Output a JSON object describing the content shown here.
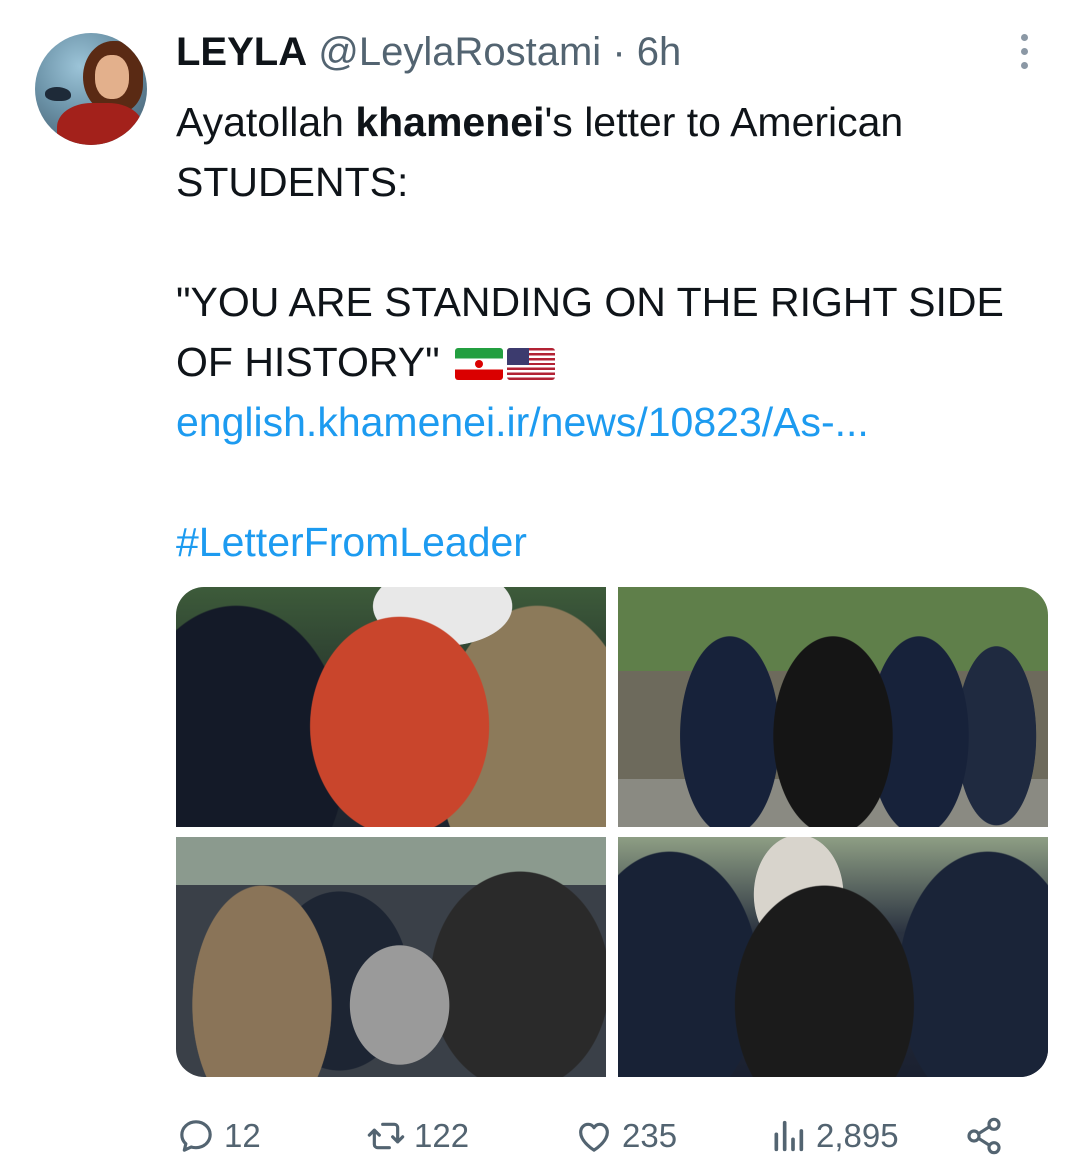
{
  "tweet": {
    "author_name": "LEYLA",
    "handle": "@LeylaRostami",
    "separator": "·",
    "time": "6h",
    "text_pre": "Ayatollah ",
    "text_bold": "khamenei",
    "text_post": "'s letter to American STUDENTS:",
    "quote": "\"YOU ARE STANDING ON THE RIGHT SIDE OF HISTORY\"",
    "flags": [
      "flag-iran",
      "flag-usa"
    ],
    "link": "english.khamenei.ir/news/10823/As-...",
    "hashtag": "#LetterFromLeader"
  },
  "media": [
    {
      "name": "photo-arrest-red-shirt"
    },
    {
      "name": "photo-arrest-black-shirt"
    },
    {
      "name": "photo-arrest-car"
    },
    {
      "name": "photo-arrest-polizei"
    }
  ],
  "actions": {
    "replies": "12",
    "reposts": "122",
    "likes": "235",
    "views": "2,895"
  },
  "icons": [
    "more-icon",
    "reply-icon",
    "repost-icon",
    "like-icon",
    "views-icon",
    "share-icon"
  ],
  "colors": {
    "link": "#1d9bf0",
    "secondary_text": "#536471",
    "text": "#0f1419"
  }
}
